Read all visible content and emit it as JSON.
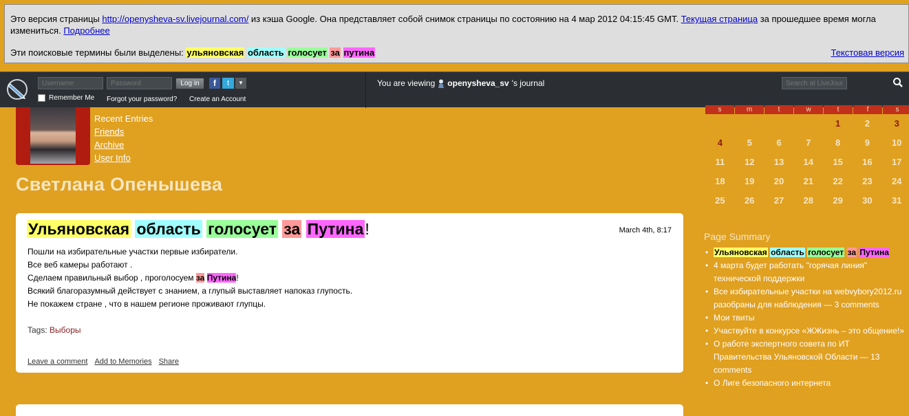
{
  "cache_banner": {
    "text_a": "Это версия страницы ",
    "cached_url": "http://openysheva-sv.livejournal.com/",
    "text_b": " из кэша Google. Она представляет собой снимок страницы по состоянию на 4 мар 2012 04:15:45 GMT. ",
    "current_page_link": "Текущая страница",
    "text_c": " за прошедшее время могла измениться. ",
    "more_link": "Подробнее",
    "terms_label": "Эти поисковые термины были выделены: ",
    "terms": [
      "ульяновская",
      "область",
      "голосует",
      "за",
      "путина"
    ],
    "text_version_link": "Текстовая версия"
  },
  "colors": {
    "hl_yellow": "#ffff66",
    "hl_cyan": "#a0ffff",
    "hl_green": "#99ff99",
    "hl_salmon": "#ff9999",
    "hl_magenta": "#ff66ff",
    "page_bg": "#e0a020",
    "calendar_header": "#c0301a"
  },
  "lj_bar": {
    "username_placeholder": "Username",
    "password_placeholder": "Password",
    "login_label": "Log in",
    "facebook_glyph": "f",
    "twitter_glyph": "t",
    "remember_label": "Remember Me",
    "forgot_label": "Forgot your password?",
    "create_label": "Create an Account",
    "viewing_prefix": "You are viewing",
    "viewing_user": "openysheva_sv",
    "viewing_suffix": "'s journal",
    "search_placeholder": "Search at LiveJournal"
  },
  "profile": {
    "nav": [
      "Recent Entries",
      "Friends",
      "Archive",
      "User Info"
    ],
    "journal_title": "Светлана Опенышева"
  },
  "entry": {
    "title_words": [
      "Ульяновская",
      "область",
      "голосует",
      "за",
      "Путина"
    ],
    "title_end": "!",
    "date": "March 4th, 8:17",
    "body_lines": [
      "Пошли на избирательные участки первые избиратели.",
      "Все веб камеры работают ."
    ],
    "line3_prefix": "Сделаем правильный выбор , проголосуем ",
    "line3_hl1": "за",
    "line3_hl2": "Путина",
    "line3_end": "!",
    "body_lines_after": [
      "Всякий благоразумный действует с знанием, а глупый выставляет напоказ глупость.",
      "Не покажем стране , что в нашем регионе проживают глупцы."
    ],
    "tags_label": "Tags: ",
    "tag": "Выборы",
    "footer_links": [
      "Leave a comment",
      "Add to Memories",
      "Share"
    ]
  },
  "calendar": {
    "weekdays": [
      "s",
      "m",
      "t",
      "w",
      "t",
      "f",
      "s"
    ],
    "rows": [
      [
        "",
        "",
        "",
        "",
        "1",
        "2",
        "3"
      ],
      [
        "4",
        "5",
        "6",
        "7",
        "8",
        "9",
        "10"
      ],
      [
        "11",
        "12",
        "13",
        "14",
        "15",
        "16",
        "17"
      ],
      [
        "18",
        "19",
        "20",
        "21",
        "22",
        "23",
        "24"
      ],
      [
        "25",
        "26",
        "27",
        "28",
        "29",
        "30",
        "31"
      ]
    ],
    "highlighted_days": [
      "1",
      "3",
      "4"
    ]
  },
  "summary": {
    "title": "Page Summary",
    "first_item_words": [
      "Ульяновская",
      "область",
      "голосует",
      "за",
      "Путина"
    ],
    "items": [
      "4 марта будет работать \"горячая линия\" технической поддержки",
      "Все избирательные участки на webvybory2012.ru разобраны для наблюдения — 3 comments",
      "Мои твиты",
      "Участвуйте в конкурсе «ЖЖизнь – это общение!»",
      "О работе экспертного совета по ИТ Правительства Ульяновской Области — 13 comments",
      "О Лиге безопасного интернета"
    ]
  }
}
